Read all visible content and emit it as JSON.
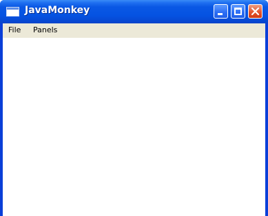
{
  "window": {
    "title": "JavaMonkey",
    "icons": {
      "app": "window-icon",
      "minimize": "minimize-icon",
      "maximize": "maximize-icon",
      "close": "close-icon"
    },
    "colors": {
      "titlebar": "#0553e2",
      "close_button": "#e2552f",
      "menubar": "#ece9d8",
      "content": "#ffffff"
    }
  },
  "menubar": {
    "items": [
      {
        "label": "File"
      },
      {
        "label": "Panels"
      }
    ]
  }
}
